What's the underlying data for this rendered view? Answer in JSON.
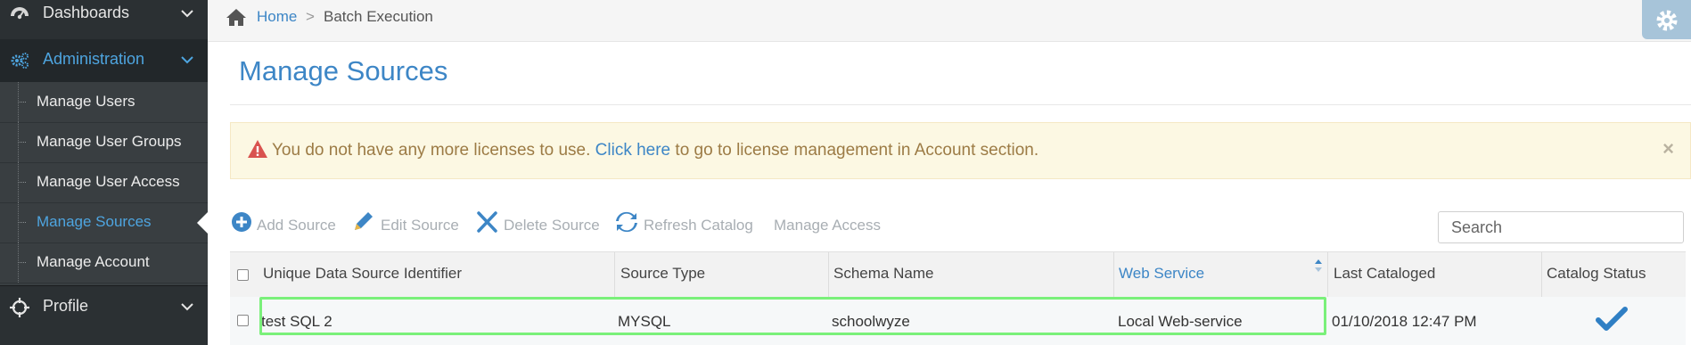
{
  "sidebar": {
    "dashboards_label": "Dashboards",
    "administration_label": "Administration",
    "profile_label": "Profile",
    "sub_items": [
      {
        "label": "Manage Users"
      },
      {
        "label": "Manage User Groups"
      },
      {
        "label": "Manage User Access"
      },
      {
        "label": "Manage Sources"
      },
      {
        "label": "Manage Account"
      }
    ],
    "active_item": "Manage Sources"
  },
  "breadcrumb": {
    "home": "Home",
    "separator": ">",
    "current": "Batch Execution"
  },
  "page": {
    "title": "Manage Sources"
  },
  "alert": {
    "text_before": "You do not have any more licenses to use.",
    "link": "Click here",
    "text_after": "to go to license management in Account section.",
    "close": "×"
  },
  "toolbar": {
    "add": "Add Source",
    "edit": "Edit Source",
    "delete": "Delete Source",
    "refresh": "Refresh Catalog",
    "access": "Manage Access"
  },
  "search": {
    "placeholder": "Search"
  },
  "table": {
    "columns": [
      "Unique Data Source Identifier",
      "Source Type",
      "Schema Name",
      "Web Service",
      "Last Cataloged",
      "Catalog Status"
    ],
    "sorted_column": "Web Service",
    "rows": [
      {
        "identifier": "test SQL 2",
        "source_type": "MYSQL",
        "schema_name": "schoolwyze",
        "web_service": "Local Web-service",
        "last_cataloged": "01/10/2018 12:47 PM",
        "catalog_status": "checkmark"
      }
    ]
  },
  "colors": {
    "accent": "#3d86c6",
    "sidebar_bg": "#2b3033",
    "alert_bg": "#fcf8e3",
    "alert_text": "#9c7b45",
    "highlight": "#7af07a"
  }
}
